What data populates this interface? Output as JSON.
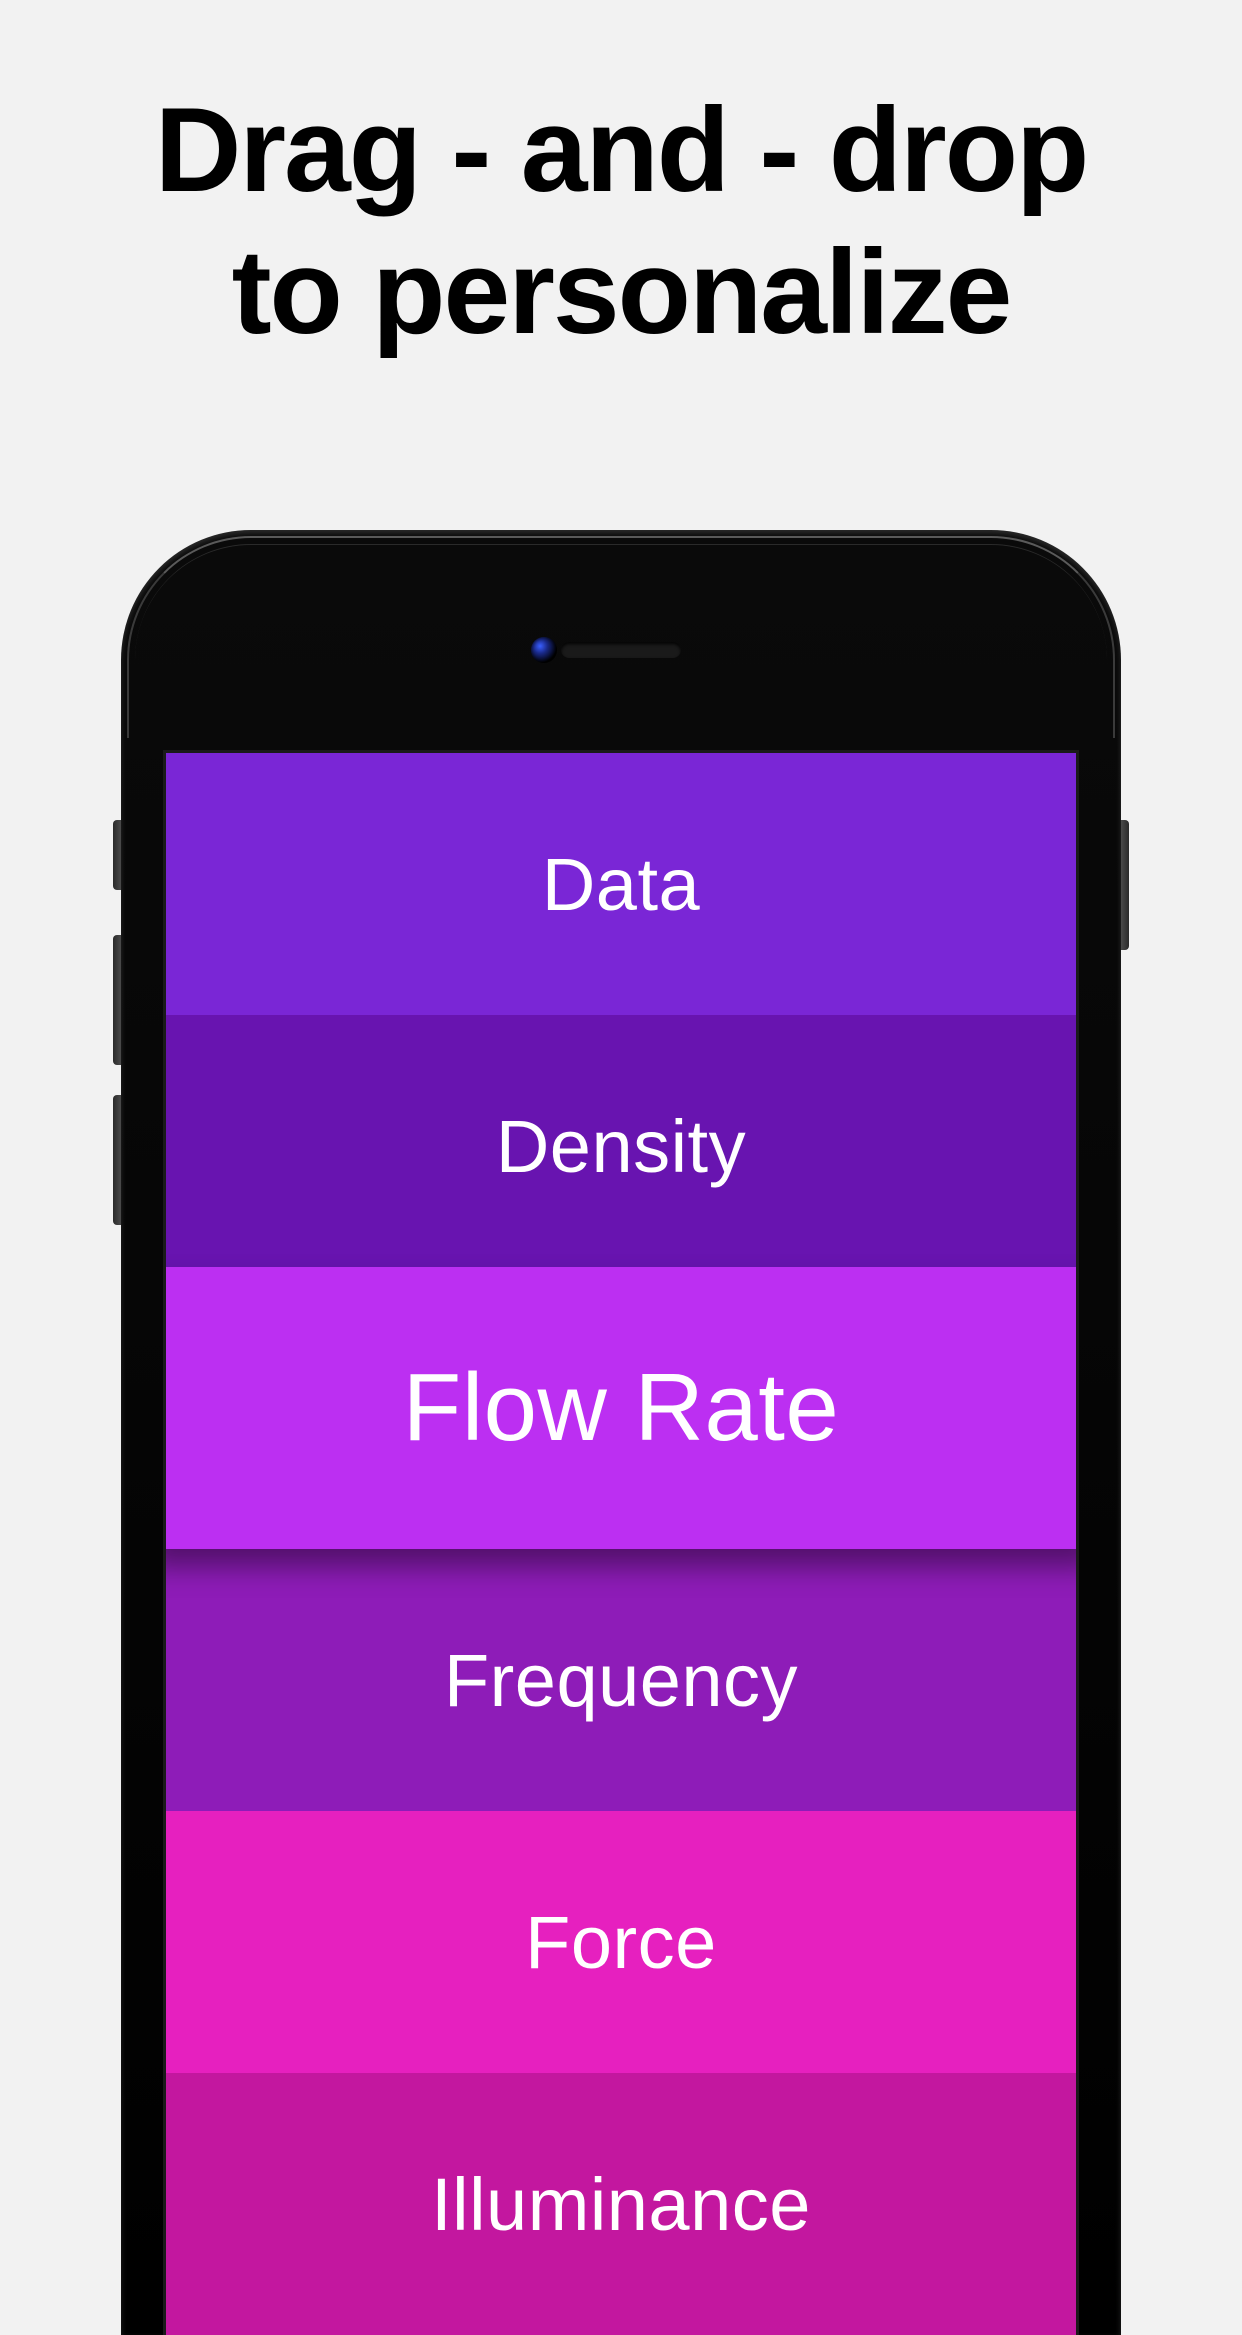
{
  "headline": {
    "line1": "Drag - and - drop",
    "line2": "to personalize"
  },
  "list": {
    "items": [
      {
        "label": "Data",
        "color": "#7a26d6"
      },
      {
        "label": "Density",
        "color": "#6814b0"
      },
      {
        "label": "Flow Rate",
        "color": "#bc2ff2",
        "dragging": true
      },
      {
        "label": "Frequency",
        "color": "#8e1cb8"
      },
      {
        "label": "Force",
        "color": "#e620bf"
      },
      {
        "label": "Illuminance",
        "color": "#c3179f"
      }
    ]
  }
}
